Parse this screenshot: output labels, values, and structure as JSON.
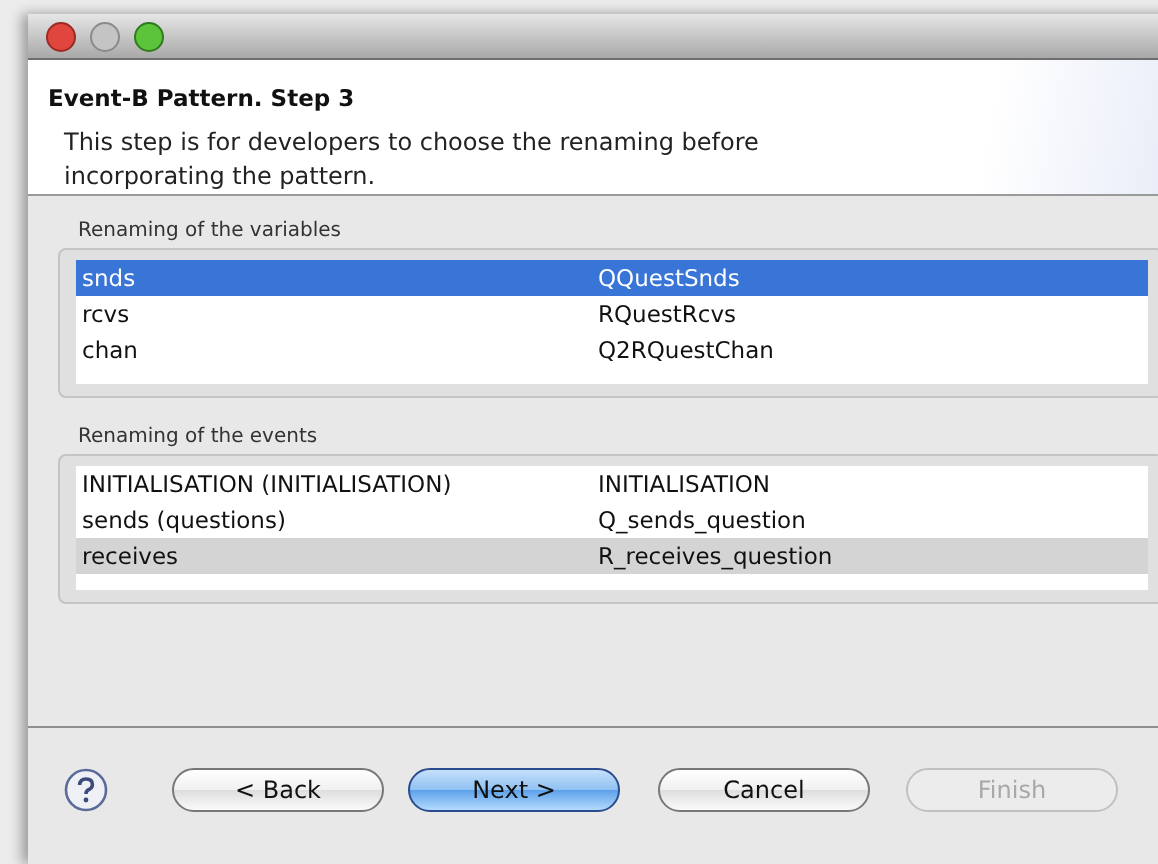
{
  "window": {
    "title": "Event-B Pattern. Step 3",
    "description": "This step is for developers to choose the renaming before incorporating the pattern."
  },
  "groups": [
    {
      "label": "Renaming of the variables",
      "focused": true,
      "rows": [
        {
          "cells": [
            "snds",
            "QQuestSnds"
          ],
          "selected": true
        },
        {
          "cells": [
            "rcvs",
            "RQuestRcvs"
          ],
          "selected": false
        },
        {
          "cells": [
            "chan",
            "Q2RQuestChan"
          ],
          "selected": false
        }
      ]
    },
    {
      "label": "Renaming of the events",
      "focused": false,
      "rows": [
        {
          "cells": [
            "INITIALISATION (INITIALISATION)",
            "INITIALISATION"
          ],
          "selected": false
        },
        {
          "cells": [
            "sends (questions)",
            "Q_sends_question"
          ],
          "selected": false
        },
        {
          "cells": [
            "receives",
            "R_receives_question"
          ],
          "selected": true
        }
      ]
    }
  ],
  "buttons": [
    {
      "label": "< Back",
      "kind": "normal",
      "disabled": false
    },
    {
      "label": "Next >",
      "kind": "default",
      "disabled": false
    },
    {
      "label": "Cancel",
      "kind": "normal",
      "disabled": false
    },
    {
      "label": "Finish",
      "kind": "normal",
      "disabled": true
    }
  ]
}
